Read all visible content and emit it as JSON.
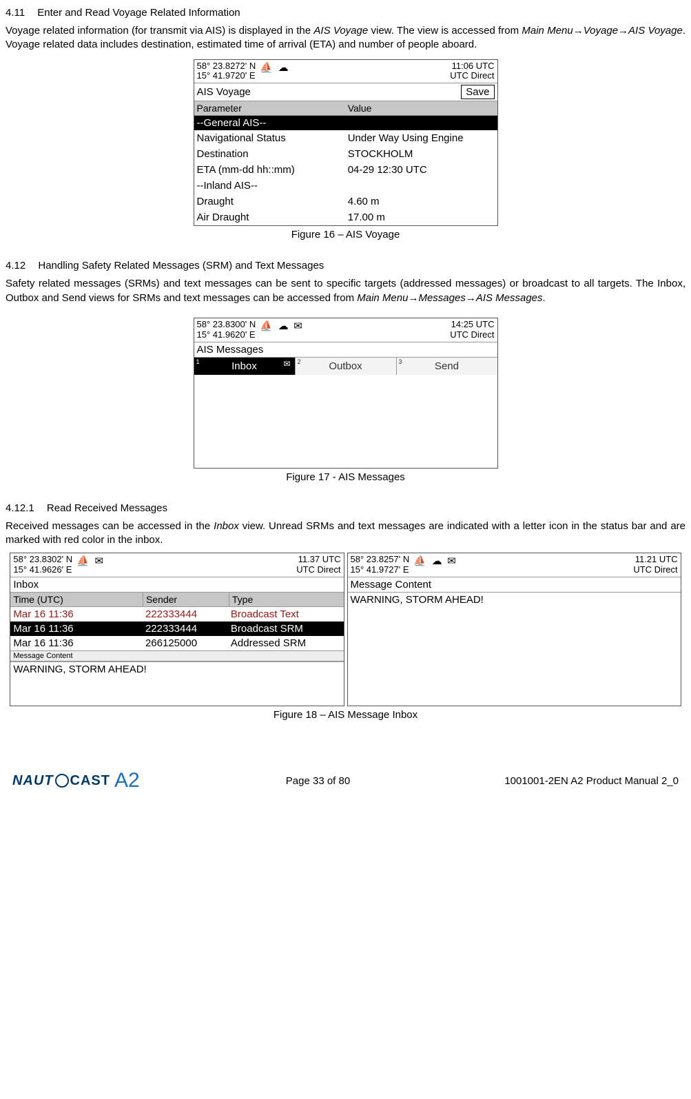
{
  "sections": {
    "s411": {
      "num": "4.11",
      "title": "Enter and Read Voyage Related Information",
      "para_parts": [
        {
          "t": "Voyage related information (for transmit via AIS) is displayed in the ",
          "i": false
        },
        {
          "t": "AIS Voyage",
          "i": true
        },
        {
          "t": " view. The view is accessed from ",
          "i": false
        },
        {
          "t": "Main Menu→Voyage→AIS Voyage",
          "i": true
        },
        {
          "t": ". Voyage related data includes destination, estimated time of arrival (ETA) and number of people aboard.",
          "i": false
        }
      ]
    },
    "s412": {
      "num": "4.12",
      "title": "Handling Safety Related Messages (SRM) and Text Messages",
      "para_parts": [
        {
          "t": "Safety related messages (SRMs) and text messages can be sent to specific targets (addressed messages) or broadcast to all targets. The Inbox, Outbox and Send views for SRMs and text messages can be accessed from ",
          "i": false
        },
        {
          "t": "Main Menu→Messages→AIS Messages",
          "i": true
        },
        {
          "t": ".",
          "i": false
        }
      ]
    },
    "s4121": {
      "num": "4.12.1",
      "title": "Read Received Messages",
      "para_parts": [
        {
          "t": "Received messages can be accessed in the ",
          "i": false
        },
        {
          "t": "Inbox",
          "i": true
        },
        {
          "t": " view. Unread SRMs and text messages are indicated with a letter icon in the status bar and are marked with red color in the inbox.",
          "i": false
        }
      ]
    }
  },
  "fig16": {
    "status": {
      "lat": "58° 23.8272' N",
      "lon": "15° 41.9720' E",
      "time": "11:06 UTC",
      "mode": "UTC Direct"
    },
    "title": "AIS Voyage",
    "save": "Save",
    "headers": {
      "p": "Parameter",
      "v": "Value"
    },
    "group": "--General AIS--",
    "rows": [
      {
        "p": "Navigational Status",
        "v": "Under Way Using Engine"
      },
      {
        "p": "Destination",
        "v": "STOCKHOLM"
      },
      {
        "p": "ETA (mm-dd hh::mm)",
        "v": "04-29 12:30 UTC"
      },
      {
        "p": "--Inland AIS--",
        "v": ""
      },
      {
        "p": "Draught",
        "v": "4.60 m"
      },
      {
        "p": "Air Draught",
        "v": "17.00 m"
      }
    ],
    "caption": "Figure 16 – AIS Voyage"
  },
  "fig17": {
    "status": {
      "lat": "58° 23.8300' N",
      "lon": "15° 41.9620' E",
      "time": "14:25 UTC",
      "mode": "UTC Direct"
    },
    "title": "AIS Messages",
    "tabs": [
      {
        "n": "1",
        "label": "Inbox",
        "active": true,
        "icon": "✉"
      },
      {
        "n": "2",
        "label": "Outbox",
        "active": false
      },
      {
        "n": "3",
        "label": "Send",
        "active": false
      }
    ],
    "caption": "Figure 17 - AIS Messages"
  },
  "fig18": {
    "left": {
      "status": {
        "lat": "58° 23.8302' N",
        "lon": "15° 41.9626' E",
        "time": "11.37 UTC",
        "mode": "UTC Direct"
      },
      "title": "Inbox",
      "headers": {
        "t": "Time (UTC)",
        "s": "Sender",
        "ty": "Type"
      },
      "rows": [
        {
          "t": "Mar 16 11:36",
          "s": "222333444",
          "ty": "Broadcast Text",
          "class": "red"
        },
        {
          "t": "Mar 16 11:36",
          "s": "222333444",
          "ty": "Broadcast SRM",
          "class": "sel"
        },
        {
          "t": "Mar 16 11:36",
          "s": "266125000",
          "ty": "Addressed SRM",
          "class": ""
        }
      ],
      "msgc_label": "Message Content",
      "msgc_text": "WARNING, STORM AHEAD!"
    },
    "right": {
      "status": {
        "lat": "58° 23.8257' N",
        "lon": "15° 41.9727' E",
        "time": "11.21 UTC",
        "mode": "UTC Direct"
      },
      "title": "Message Content",
      "text": "WARNING, STORM AHEAD!"
    },
    "caption": "Figure 18 – AIS Message Inbox"
  },
  "footer": {
    "logo1": "NAUT",
    "logo2": "CAST",
    "logo3": "A2",
    "page": "Page 33 of 80",
    "doc": "1001001-2EN A2 Product Manual 2_0"
  }
}
